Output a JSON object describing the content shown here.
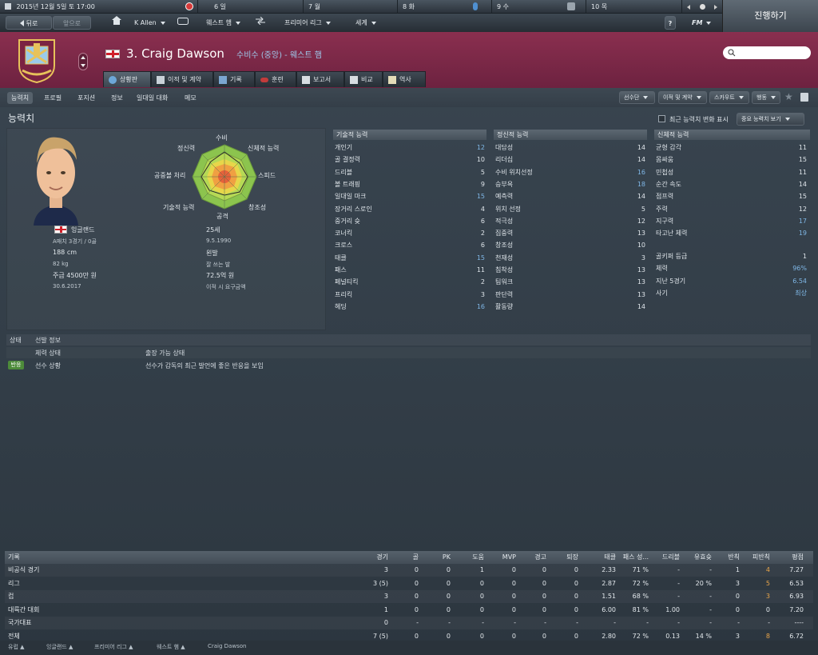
{
  "topbar": {
    "date": "2015년 12월 5일 토 17:00",
    "days": [
      "6 일",
      "7 월",
      "8 화",
      "9 수",
      "10 목"
    ]
  },
  "nav": {
    "back": "뒤로",
    "forward": "앞으로",
    "manager": "K Allen",
    "club": "웨스트 햄",
    "league": "프리미어 리그",
    "world": "세계",
    "help": "?",
    "fm": "FM",
    "continue": "진행하기"
  },
  "player": {
    "number_name": "3. Craig Dawson",
    "role_club": "수비수 (중앙) - 웨스트 햄"
  },
  "tabs": [
    "상황판",
    "이적 및 계약",
    "기록",
    "훈련",
    "보고서",
    "비교",
    "역사"
  ],
  "subtabs": [
    "능력치",
    "프로필",
    "포지션",
    "정보",
    "일대일 대화",
    "메모"
  ],
  "dropdowns": [
    "선수단",
    "이적 및 계약",
    "스카우트",
    "행동"
  ],
  "page_title": "능력치",
  "recent_changes_label": "최근 능력치 변화 표시",
  "key_attrs_button": "중요 능력치 보기",
  "radar_labels": [
    "수비",
    "신체적 능력",
    "스피드",
    "창조성",
    "공격",
    "기술적 능력",
    "공중볼 처리",
    "정신력"
  ],
  "info": {
    "nation": "잉글랜드",
    "caps": "A매치 3경기 / 0골",
    "height": "188 cm",
    "weight": "82 kg",
    "wage": "주급 4500만 원",
    "contract_end": "30.6.2017",
    "age": "25세",
    "dob": "9.5.1990",
    "foot": "왼발",
    "foot_note": "잘 쓰는 발",
    "value": "72.5억 원",
    "value_note": "이적 시 요구금액"
  },
  "technical": {
    "title": "기술적 능력",
    "rows": [
      {
        "name": "개인기",
        "value": "12",
        "hi": true
      },
      {
        "name": "골 결정력",
        "value": "10",
        "hi": false
      },
      {
        "name": "드리블",
        "value": "5",
        "hi": false
      },
      {
        "name": "볼 트래핑",
        "value": "9",
        "hi": false
      },
      {
        "name": "일대일 마크",
        "value": "15",
        "hi": true
      },
      {
        "name": "장거리 스로인",
        "value": "4",
        "hi": false
      },
      {
        "name": "중거리 슛",
        "value": "6",
        "hi": false
      },
      {
        "name": "코너킥",
        "value": "2",
        "hi": false
      },
      {
        "name": "크로스",
        "value": "6",
        "hi": false
      },
      {
        "name": "태클",
        "value": "15",
        "hi": true
      },
      {
        "name": "패스",
        "value": "11",
        "hi": false
      },
      {
        "name": "페널티킥",
        "value": "2",
        "hi": false
      },
      {
        "name": "프리킥",
        "value": "3",
        "hi": false
      },
      {
        "name": "헤딩",
        "value": "16",
        "hi": true
      }
    ]
  },
  "mental": {
    "title": "정신적 능력",
    "rows": [
      {
        "name": "대담성",
        "value": "14",
        "hi": false
      },
      {
        "name": "리더십",
        "value": "14",
        "hi": false
      },
      {
        "name": "수비 위치선정",
        "value": "16",
        "hi": true
      },
      {
        "name": "승부욕",
        "value": "18",
        "hi": true
      },
      {
        "name": "예측력",
        "value": "14",
        "hi": false
      },
      {
        "name": "위치 선정",
        "value": "5",
        "hi": false
      },
      {
        "name": "적극성",
        "value": "12",
        "hi": false
      },
      {
        "name": "집중력",
        "value": "13",
        "hi": false
      },
      {
        "name": "창조성",
        "value": "10",
        "hi": false
      },
      {
        "name": "천재성",
        "value": "3",
        "hi": false
      },
      {
        "name": "침착성",
        "value": "13",
        "hi": false
      },
      {
        "name": "팀워크",
        "value": "13",
        "hi": false
      },
      {
        "name": "판단력",
        "value": "13",
        "hi": false
      },
      {
        "name": "활동량",
        "value": "14",
        "hi": false
      }
    ]
  },
  "physical": {
    "title": "신체적 능력",
    "rows": [
      {
        "name": "균형 감각",
        "value": "11",
        "hi": false
      },
      {
        "name": "몸싸움",
        "value": "15",
        "hi": false
      },
      {
        "name": "민첩성",
        "value": "11",
        "hi": false
      },
      {
        "name": "순간 속도",
        "value": "14",
        "hi": false
      },
      {
        "name": "점프력",
        "value": "15",
        "hi": false
      },
      {
        "name": "주력",
        "value": "12",
        "hi": false
      },
      {
        "name": "지구력",
        "value": "17",
        "hi": true
      },
      {
        "name": "타고난 체력",
        "value": "19",
        "hi": true
      }
    ],
    "extra": [
      {
        "name": "골키퍼 등급",
        "value": "1",
        "hi": false
      },
      {
        "name": "체력",
        "value": "96%",
        "hi": true
      },
      {
        "name": "지난 5경기",
        "value": "6.54",
        "hi": true
      },
      {
        "name": "사기",
        "value": "최상",
        "hi": true
      }
    ]
  },
  "status": {
    "header_label": "상태",
    "header_title": "선발 정보",
    "rows": [
      {
        "badge": "",
        "label": "체력 상태",
        "value": "출장 가능 상태"
      },
      {
        "badge": "반응",
        "label": "선수 상황",
        "value": "선수가 감독의 최근 발언에 좋은 반응을 보임"
      }
    ]
  },
  "stats": {
    "headers": [
      "기록",
      "경기",
      "골",
      "PK",
      "도움",
      "MVP",
      "경고",
      "퇴장",
      "태클",
      "패스 성...",
      "드리블",
      "유효슛",
      "반칙",
      "피반칙",
      "평점"
    ],
    "rows": [
      [
        "비공식 경기",
        "3",
        "0",
        "0",
        "1",
        "0",
        "0",
        "0",
        "2.33",
        "71 %",
        "-",
        "-",
        "1",
        "4",
        "7.27"
      ],
      [
        "리그",
        "3 (5)",
        "0",
        "0",
        "0",
        "0",
        "0",
        "0",
        "2.87",
        "72 %",
        "-",
        "20 %",
        "3",
        "5",
        "6.53"
      ],
      [
        "컵",
        "3",
        "0",
        "0",
        "0",
        "0",
        "0",
        "0",
        "1.51",
        "68 %",
        "-",
        "-",
        "0",
        "3",
        "6.93"
      ],
      [
        "대륙간 대회",
        "1",
        "0",
        "0",
        "0",
        "0",
        "0",
        "0",
        "6.00",
        "81 %",
        "1.00",
        "-",
        "0",
        "0",
        "7.20"
      ],
      [
        "국가대표",
        "0",
        "-",
        "-",
        "-",
        "-",
        "-",
        "-",
        "-",
        "-",
        "-",
        "-",
        "-",
        "-",
        "----"
      ],
      [
        "전체",
        "7 (5)",
        "0",
        "0",
        "0",
        "0",
        "0",
        "0",
        "2.80",
        "72 %",
        "0.13",
        "14 %",
        "3",
        "8",
        "6.72"
      ]
    ]
  },
  "footer": [
    "유럽",
    "잉글랜드",
    "프리미어 리그",
    "웨스트 햄",
    "Craig Dawson"
  ],
  "colors": {
    "header_bg": "#7a2646",
    "accent_blue": "#7fb7e6",
    "orange": "#e9a54a"
  }
}
